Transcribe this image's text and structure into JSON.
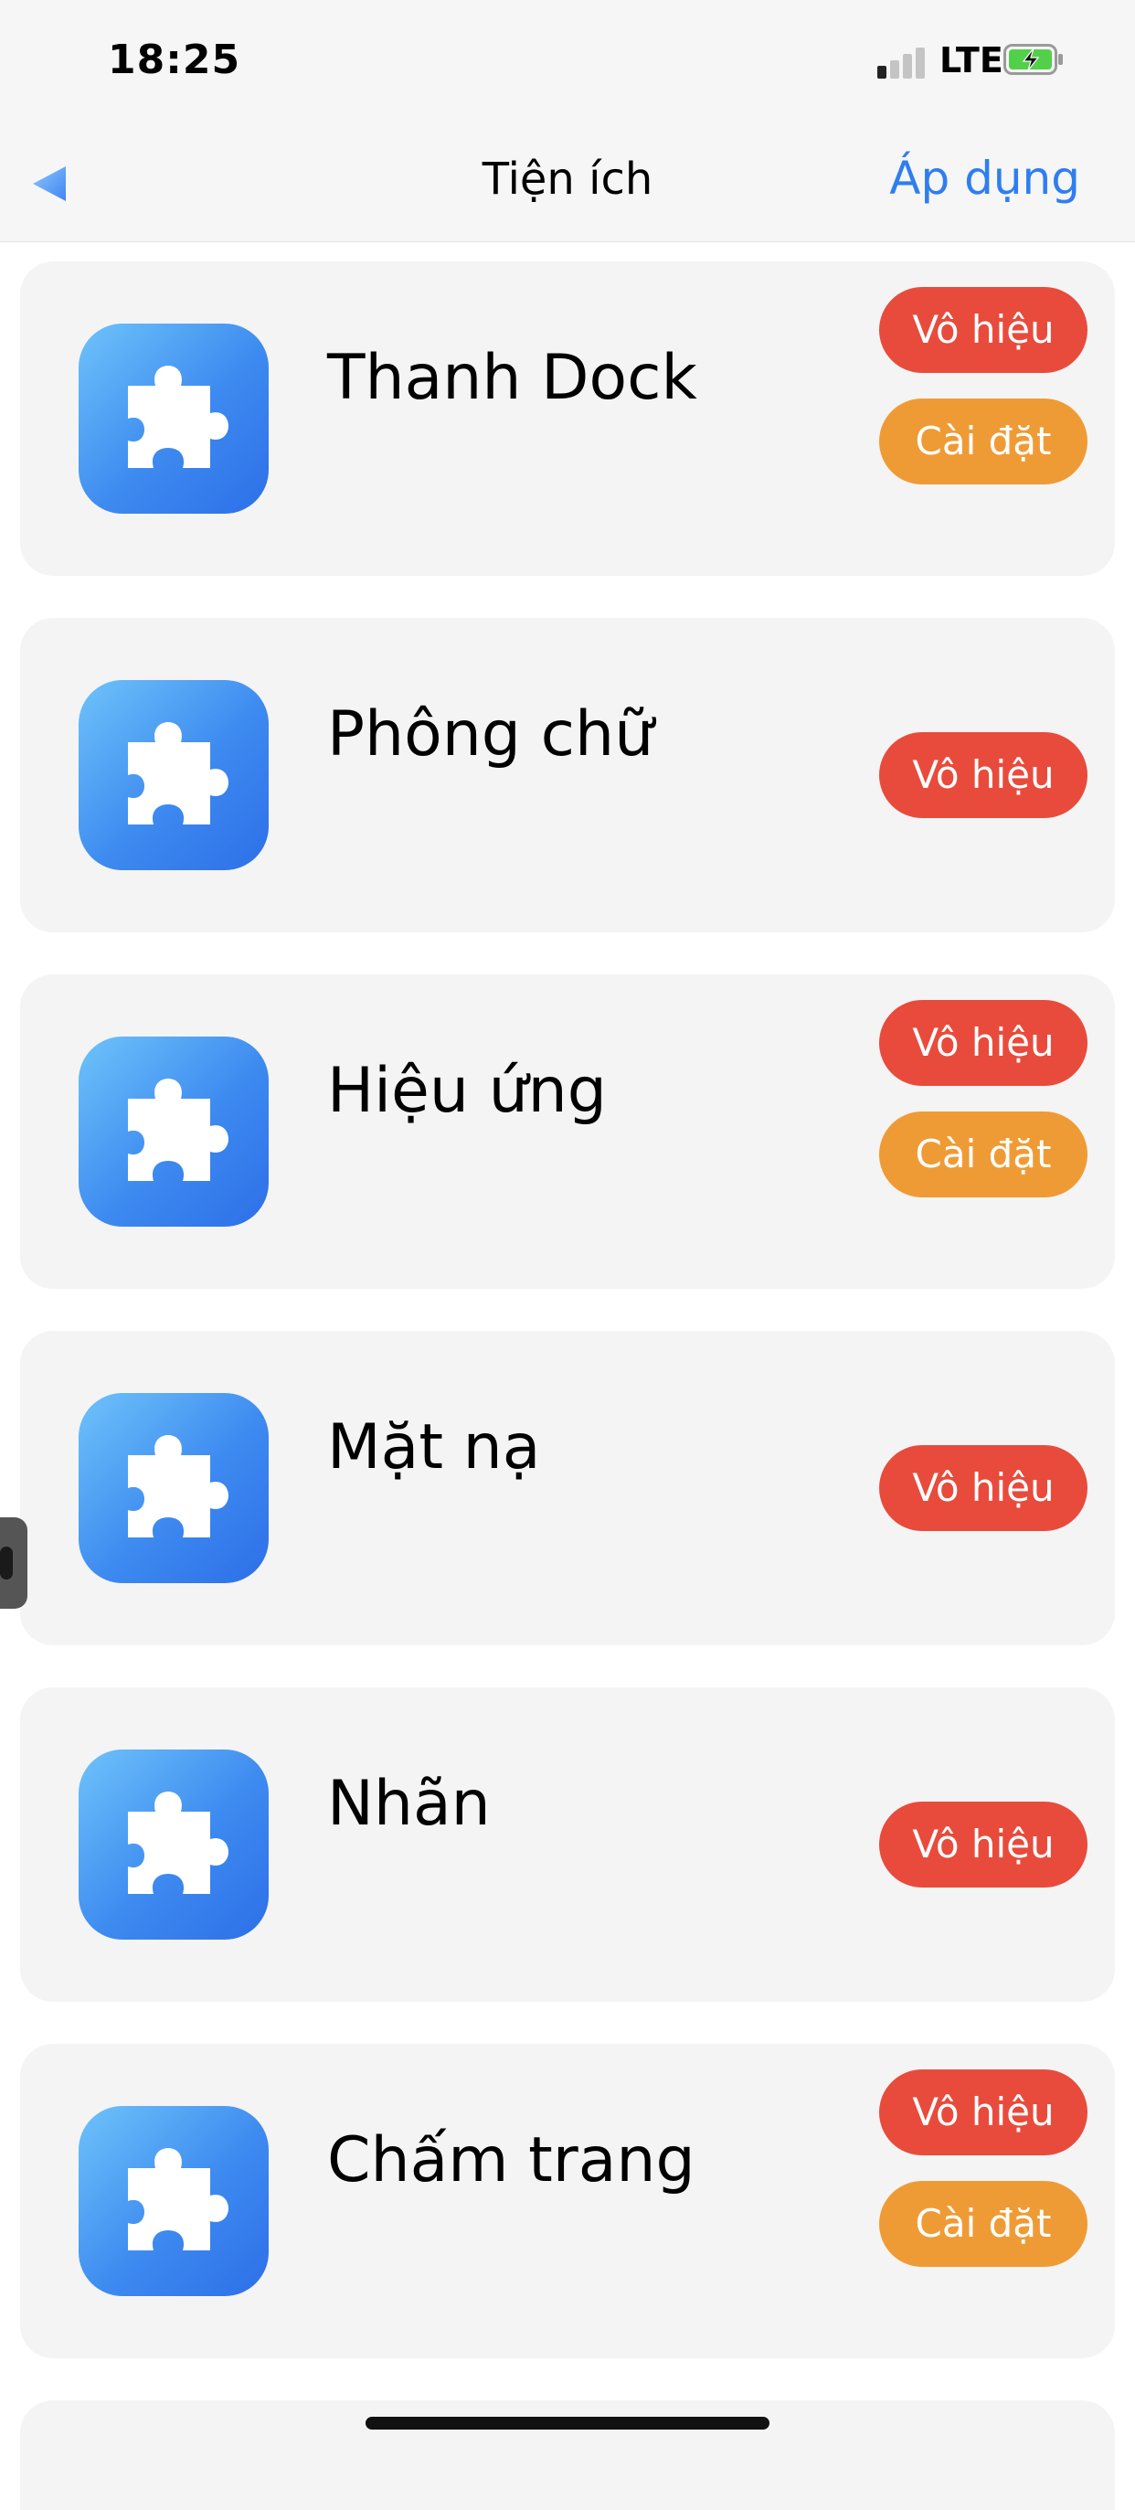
{
  "status_bar": {
    "time": "18:25",
    "network": "LTE",
    "signal_bars": 1,
    "battery_charging": true
  },
  "nav": {
    "back_icon": "triangle-back-icon",
    "title": "Tiện ích",
    "apply_label": "Áp dụng",
    "accent_color": "#2f7ef0"
  },
  "colors": {
    "disable_button": "#e84b3c",
    "settings_button": "#ef9b35",
    "icon_gradient": [
      "#6fc3fa",
      "#2d6fe8"
    ]
  },
  "extensions": [
    {
      "name": "Thanh Dock",
      "icon": "puzzle-icon",
      "disable_label": "Vô hiệu",
      "settings_label": "Cài đặt"
    },
    {
      "name": "Phông chữ",
      "icon": "puzzle-icon",
      "disable_label": "Vô hiệu"
    },
    {
      "name": "Hiệu ứng",
      "icon": "puzzle-icon",
      "disable_label": "Vô hiệu",
      "settings_label": "Cài đặt"
    },
    {
      "name": "Mặt nạ",
      "icon": "puzzle-icon",
      "disable_label": "Vô hiệu"
    },
    {
      "name": "Nhãn",
      "icon": "puzzle-icon",
      "disable_label": "Vô hiệu"
    },
    {
      "name": "Chấm trang",
      "icon": "puzzle-icon",
      "disable_label": "Vô hiệu",
      "settings_label": "Cài đặt"
    }
  ]
}
